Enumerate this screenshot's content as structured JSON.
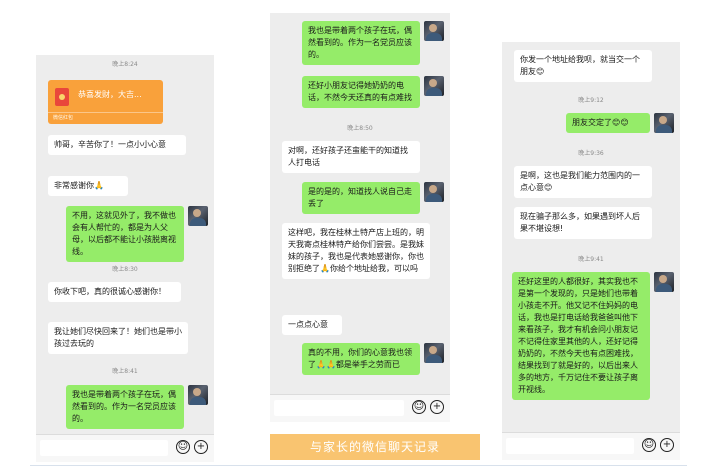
{
  "panel1": {
    "time1": "晚上8:24",
    "red_packet_title": "恭喜发财，大吉...",
    "red_packet_label": "微信红包",
    "m1": "帅哥，辛苦你了！一点小小心意",
    "m2": "非常感谢你🙏",
    "m3": "不用，这就见外了，我不做也会有人帮忙的，都是为人父母，以后都不能让小孩脱离视线。",
    "time2": "晚上8:30",
    "m4": "你收下吧，真的很诚心感谢你！",
    "m5": "我让她们尽快回来了！她们也是带小孩过去玩的",
    "time3": "晚上8:41",
    "m6": "我也是带着两个孩子在玩，偶然看到的。作为一名党员应该的。"
  },
  "panel2": {
    "m1": "我也是带着两个孩子在玩，偶然看到的。作为一名党员应该的。",
    "m2": "还好小朋友记得她奶奶的电话，不然今天还真的有点难找",
    "time1": "晚上8:50",
    "m3": "对啊，还好孩子还蛮能干的知道找人打电话",
    "m4": "是的是的，知道找人说自己走丢了",
    "m5": "这样吧，我在桂林土特产店上班的，明天我寄点桂林特产给你们尝尝。是我妹妹的孩子，我也是代表她感谢你，你也别拒绝了🙏你给个地址给我，可以吗",
    "m6": "一点点心意",
    "m7": "真的不用，你们的心意我也领了🙏🙏都是举手之劳而已"
  },
  "panel3": {
    "m1": "你发一个地址给我呗，就当交一个朋友😊",
    "time1": "晚上9:12",
    "m2": "朋友交定了😊😊",
    "time2": "晚上9:36",
    "m3": "是啊，这也是我们能力范围内的一点心意😊",
    "m4": "现在骗子那么多，如果遇到坏人后果不堪设想!",
    "time3": "晚上9:41",
    "m5": "还好这里的人都很好，其实我也不是第一个发现的，只是她们也带着小孩走不开。他又记不住妈妈的电话，我也是打电话给我爸爸叫他下来看孩子，我才有机会问小朋友记不记得住家里其他的人，还好记得奶奶的，不然今天也有点困难找，结果找到了就是好的，以后出来人多的地方，千万记住不要让孩子离开视线。"
  },
  "caption": "与家长的微信聊天记录",
  "icons": {
    "emoji": "emoji-icon",
    "plus": "plus-icon",
    "avatar": "avatar-icon"
  },
  "colors": {
    "sent_bubble": "#95ec69",
    "received_bubble": "#ffffff",
    "red_packet": "#f9a13b",
    "caption_bg": "#f9c470"
  }
}
